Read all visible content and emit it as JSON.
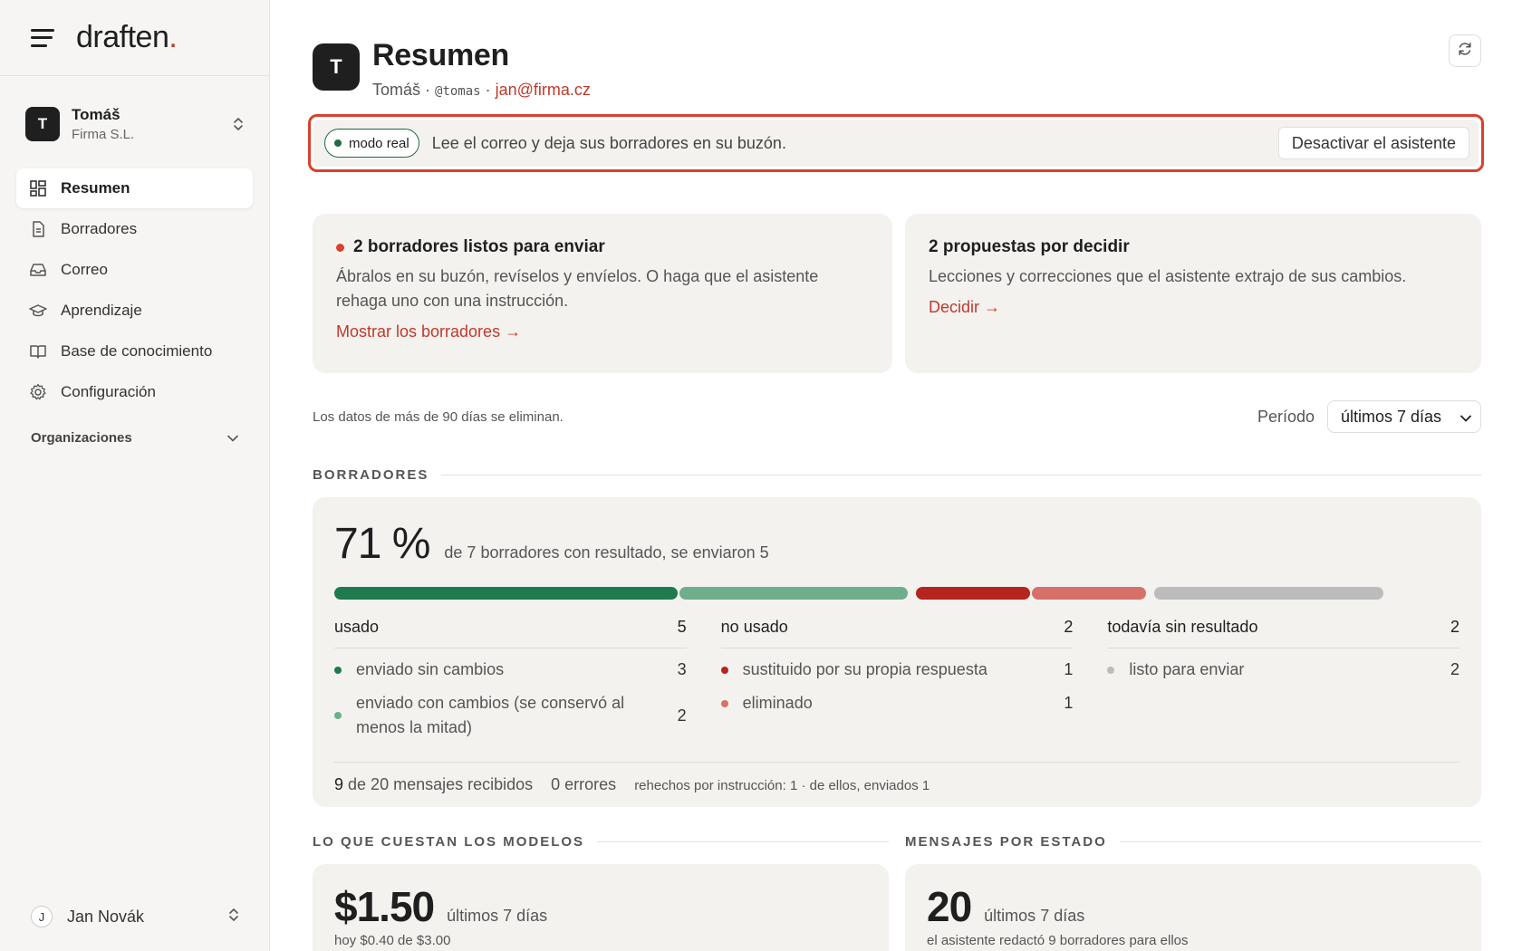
{
  "brand": {
    "name": "draften",
    "dot": "."
  },
  "account": {
    "initial": "T",
    "name": "Tomáš",
    "org": "Firma S.L."
  },
  "nav": [
    {
      "label": "Resumen",
      "icon": "grid-icon",
      "active": true
    },
    {
      "label": "Borradores",
      "icon": "document-icon"
    },
    {
      "label": "Correo",
      "icon": "inbox-icon"
    },
    {
      "label": "Aprendizaje",
      "icon": "graduation-cap-icon"
    },
    {
      "label": "Base de conocimiento",
      "icon": "book-icon"
    },
    {
      "label": "Configuración",
      "icon": "gear-icon"
    }
  ],
  "orgs_label": "Organizaciones",
  "user": {
    "initial": "J",
    "name": "Jan Novák"
  },
  "header": {
    "initial": "T",
    "title": "Resumen",
    "name": "Tomáš",
    "sep1": " · ",
    "handle": "@tomas",
    "sep2": " · ",
    "email": "jan@firma.cz"
  },
  "banner": {
    "pill": "modo real",
    "text": "Lee el correo y deja sus borradores en su buzón.",
    "button": "Desactivar el asistente"
  },
  "cards": {
    "drafts": {
      "title": "2 borradores listos para enviar",
      "body": "Ábralos en su buzón, revíselos y envíelos. O haga que el asistente rehaga uno con una instrucción.",
      "link": "Mostrar los borradores →"
    },
    "proposals": {
      "title": "2 propuestas por decidir",
      "body": "Lecciones y correcciones que el asistente extrajo de sus cambios.",
      "link": "Decidir →"
    }
  },
  "retention": "Los datos de más de 90 días se eliminan.",
  "period": {
    "label": "Período",
    "value": "últimos 7 días"
  },
  "borradores": {
    "section": "BORRADORES",
    "pct": "71 %",
    "desc": "de 7 borradores con resultado, se enviaron 5",
    "bar": {
      "used": [
        {
          "value": 3,
          "color": "#1f7a4d"
        },
        {
          "value": 2,
          "color": "#6fae8a"
        }
      ],
      "unused": [
        {
          "value": 1,
          "color": "#b5251d"
        },
        {
          "value": 1,
          "color": "#d67069"
        }
      ],
      "pending": [
        {
          "value": 2,
          "color": "#bdbcbc"
        }
      ]
    },
    "cols": [
      {
        "label": "usado",
        "count": "5",
        "items": [
          {
            "label": "enviado sin cambios",
            "count": "3",
            "color": "#1f7a4d"
          },
          {
            "label": "enviado con cambios (se conservó al menos la mitad)",
            "count": "2",
            "color": "#6fae8a"
          }
        ]
      },
      {
        "label": "no usado",
        "count": "2",
        "items": [
          {
            "label": "sustituido por su propia respuesta",
            "count": "1",
            "color": "#b5251d"
          },
          {
            "label": "eliminado",
            "count": "1",
            "color": "#d67069"
          }
        ]
      },
      {
        "label": "todavía sin resultado",
        "count": "2",
        "items": [
          {
            "label": "listo para enviar",
            "count": "2",
            "color": "#bdbcbc"
          }
        ]
      }
    ],
    "stats": {
      "received_num": "9",
      "received_text": "de 20 mensajes recibidos",
      "errors": "0 errores",
      "redo": "rehechos por instrucción: 1 · de ellos, enviados 1"
    }
  },
  "costs": {
    "section": "LO QUE CUESTAN LOS MODELOS",
    "value": "$1.50",
    "period": "últimos 7 días",
    "sub": "hoy $0.40 de $3.00"
  },
  "messages": {
    "section": "MENSAJES POR ESTADO",
    "value": "20",
    "period": "últimos 7 días",
    "sub": "el asistente redactó 9 borradores para ellos"
  }
}
